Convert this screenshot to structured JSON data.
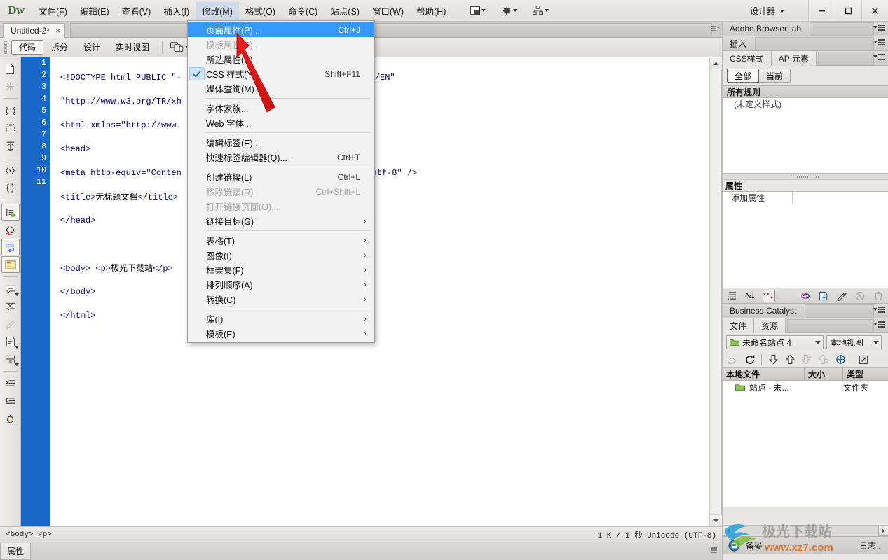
{
  "app": {
    "logo": "Dw"
  },
  "menubar": {
    "items": [
      {
        "label": "文件(F)",
        "name": "menu-file"
      },
      {
        "label": "编辑(E)",
        "name": "menu-edit"
      },
      {
        "label": "查看(V)",
        "name": "menu-view"
      },
      {
        "label": "插入(I)",
        "name": "menu-insert"
      },
      {
        "label": "修改(M)",
        "name": "menu-modify",
        "active": true
      },
      {
        "label": "格式(O)",
        "name": "menu-format"
      },
      {
        "label": "命令(C)",
        "name": "menu-commands"
      },
      {
        "label": "站点(S)",
        "name": "menu-site"
      },
      {
        "label": "窗口(W)",
        "name": "menu-window"
      },
      {
        "label": "帮助(H)",
        "name": "menu-help"
      }
    ],
    "workspace_label": "设计器"
  },
  "dropdown": {
    "groups": [
      [
        {
          "label": "页面属性(P)...",
          "accel": "Ctrl+J",
          "highlighted": true
        },
        {
          "label": "模板属性(P)...",
          "disabled": true
        },
        {
          "label": "所选属性(S)"
        },
        {
          "label": "CSS 样式(Y)",
          "accel": "Shift+F11",
          "checked": true
        },
        {
          "label": "媒体查询(M)..."
        }
      ],
      [
        {
          "label": "字体家族..."
        },
        {
          "label": "Web 字体..."
        }
      ],
      [
        {
          "label": "编辑标签(E)..."
        },
        {
          "label": "快速标签编辑器(Q)...",
          "accel": "Ctrl+T"
        }
      ],
      [
        {
          "label": "创建链接(L)",
          "accel": "Ctrl+L"
        },
        {
          "label": "移除链接(R)",
          "accel": "Ctrl+Shift+L",
          "disabled": true
        },
        {
          "label": "打开链接页面(O)...",
          "disabled": true
        },
        {
          "label": "链接目标(G)",
          "submenu": true
        }
      ],
      [
        {
          "label": "表格(T)",
          "submenu": true
        },
        {
          "label": "图像(I)",
          "submenu": true
        },
        {
          "label": "框架集(F)",
          "submenu": true
        },
        {
          "label": "排列顺序(A)",
          "submenu": true
        },
        {
          "label": "转换(C)",
          "submenu": true
        }
      ],
      [
        {
          "label": "库(I)",
          "submenu": true
        },
        {
          "label": "模板(E)",
          "submenu": true
        }
      ]
    ]
  },
  "document": {
    "tab_title": "Untitled-2*",
    "close_label": "×",
    "view_buttons": [
      {
        "label": "代码",
        "name": "view-code",
        "selected": true
      },
      {
        "label": "拆分",
        "name": "view-split"
      },
      {
        "label": "设计",
        "name": "view-design"
      },
      {
        "label": "实时视图",
        "name": "view-live"
      }
    ],
    "title_field_value": "",
    "title_field_placeholder": ""
  },
  "code": {
    "line_numbers": [
      "1",
      "2",
      "3",
      "4",
      "5",
      "6",
      "7",
      "8",
      "9",
      "10",
      "11"
    ],
    "lines": [
      "<!DOCTYPE html PUBLIC \"-",
      "\"http://www.w3.org/TR/xh",
      "<html xmlns=\"http://www.",
      "<head>",
      "<meta http-equiv=\"Conten",
      "<title>无标题文档</title>",
      "</head>",
      "",
      "<body> <p>极光下载站</p>",
      "</body>",
      "</html>",
      ""
    ],
    "doctype_tail": "/EN\"",
    "meta_tail": "et=utf-8\" />",
    "title_text": "无标题文档",
    "body_text": "极光下载站"
  },
  "statusbar": {
    "tag_path": "<body> <p>",
    "doc_info": "1 K / 1 秒 Unicode (UTF-8)",
    "properties_tab": "属性"
  },
  "panels": {
    "browserlab": {
      "title": "Adobe BrowserLab"
    },
    "insert": {
      "title": "插入"
    },
    "css": {
      "tabs": [
        {
          "label": "CSS样式",
          "active": true
        },
        {
          "label": "AP 元素",
          "active": false
        }
      ],
      "segments": [
        {
          "label": "全部",
          "on": true
        },
        {
          "label": "当前",
          "on": false
        }
      ],
      "rules_header": "所有规则",
      "rules": [
        "(未定义样式)"
      ]
    },
    "properties": {
      "header": "属性",
      "add_property": "添加属性"
    },
    "business_catalyst": {
      "title": "Business Catalyst"
    },
    "files": {
      "tabs": [
        {
          "label": "文件",
          "active": true
        },
        {
          "label": "资源",
          "active": false
        }
      ],
      "site_combo": "未命名站点 4",
      "view_combo": "本地视图",
      "columns": [
        "本地文件",
        "大小",
        "类型"
      ],
      "rows": [
        {
          "name": "站点 - 未...",
          "size": "",
          "type": "文件夹"
        }
      ],
      "status_label": "备妥",
      "log_label": "日志..."
    }
  },
  "watermark": {
    "title": "极光下载站",
    "url": "www.xz7.com"
  },
  "colors": {
    "accent_blue": "#1968c8",
    "menu_highlight": "#3399ff",
    "code_tag": "#000080",
    "arrow_red": "#e01b1b",
    "folder_green": "#7cb342"
  }
}
